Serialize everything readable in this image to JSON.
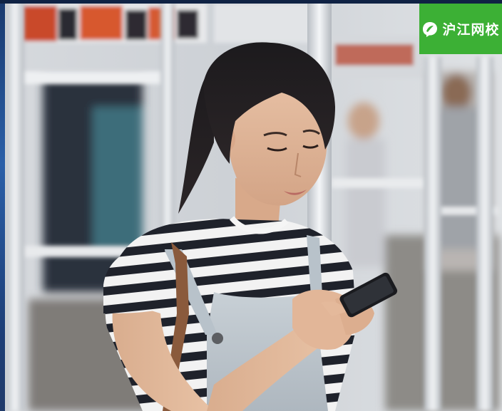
{
  "logo": {
    "text": "沪江网校",
    "icon": "leaf-chat-bubble-icon",
    "background_color": "#3cb035",
    "text_color": "#ffffff"
  },
  "scene": {
    "subject": "woman-looking-at-phone",
    "setting": "subway-car",
    "dominant_colors": [
      "#c8ccd2",
      "#e9ecef",
      "#2a2c35",
      "#9b6a4b"
    ]
  },
  "frame": {
    "edge_color": "#1e3f78"
  }
}
